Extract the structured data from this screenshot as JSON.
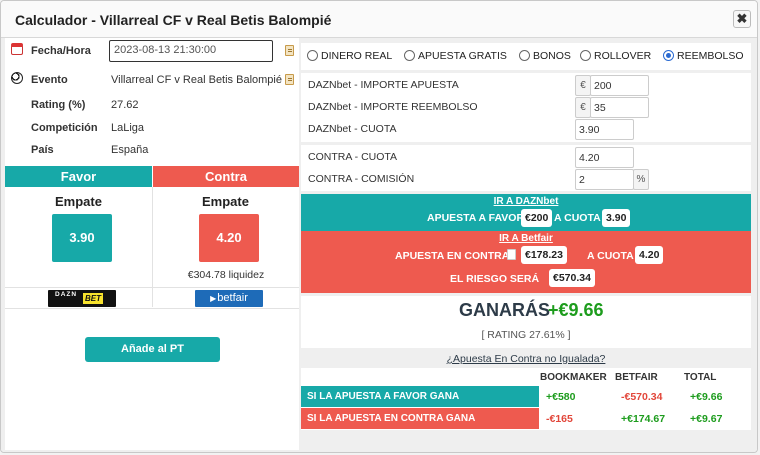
{
  "app": {
    "title": "Calculador - Villarreal CF v Real Betis Balompié",
    "close_label": "✖"
  },
  "background": {
    "corner_text": "0"
  },
  "match_info": {
    "date_label": "Fecha/Hora",
    "date_value": "2023-08-13 21:30:00",
    "event_label": "Evento",
    "event_value": "Villarreal CF v Real Betis Balompié",
    "rating_label": "Rating (%)",
    "rating_value": "27.62",
    "competition_label": "Competición",
    "competition_value": "LaLiga",
    "country_label": "País",
    "country_value": "España"
  },
  "favor": {
    "header": "Favor",
    "selection": "Empate",
    "odds": "3.90",
    "bookmaker_logo_text": "DAZN",
    "bookmaker_logo_badge": "BET"
  },
  "contra": {
    "header": "Contra",
    "selection": "Empate",
    "odds": "4.20",
    "liquidity": "€304.78 liquidez",
    "exchange_logo_text": "betfair"
  },
  "add_button": "Añade al PT",
  "modes": [
    {
      "label": "DINERO REAL",
      "checked": false
    },
    {
      "label": "APUESTA GRATIS",
      "checked": false
    },
    {
      "label": "BONOS",
      "checked": false
    },
    {
      "label": "ROLLOVER",
      "checked": false
    },
    {
      "label": "REEMBOLSO",
      "checked": true
    }
  ],
  "params": {
    "stake_label": "DAZNbet - IMPORTE APUESTA",
    "stake_currency": "€",
    "stake_value": "200",
    "refund_label": "DAZNbet - IMPORTE REEMBOLSO",
    "refund_currency": "€",
    "refund_value": "35",
    "back_odds_label": "DAZNbet - CUOTA",
    "back_odds_value": "3.90",
    "lay_odds_label": "CONTRA - CUOTA",
    "lay_odds_value": "4.20",
    "commission_label": "CONTRA - COMISIÓN",
    "commission_value": "2",
    "commission_unit": "%"
  },
  "dazn_band": {
    "link": "IR A DAZNbet",
    "text_a": "APUESTA A FAVOR",
    "stake": "€200",
    "text_b": "A CUOTA",
    "odds": "3.90"
  },
  "betfair_band": {
    "link": "IR A Betfair",
    "text_a": "APUESTA EN CONTRA",
    "lay_stake": "€178.23",
    "text_b": "A CUOTA",
    "odds": "4.20",
    "risk_text": "EL RIESGO SERÁ",
    "risk_value": "€570.34"
  },
  "result": {
    "label": "GANARÁS",
    "value": "+€9.66",
    "rating_text": "[ RATING 27.61% ]"
  },
  "mismatch_link": "¿Apuesta En Contra no Igualada?",
  "outcomes": {
    "headers": [
      "BOOKMAKER",
      "BETFAIR",
      "TOTAL"
    ],
    "rows": [
      {
        "label": "SI LA APUESTA A FAVOR GANA",
        "bookmaker": "+€580",
        "betfair": "-€570.34",
        "total": "+€9.66"
      },
      {
        "label": "SI LA APUESTA EN CONTRA GANA",
        "bookmaker": "-€165",
        "betfair": "+€174.67",
        "total": "+€9.67"
      }
    ]
  },
  "colors": {
    "teal": "#17a9a8",
    "red": "#ee5a4f",
    "positive": "#1d9c1d",
    "negative": "#e2463a"
  }
}
